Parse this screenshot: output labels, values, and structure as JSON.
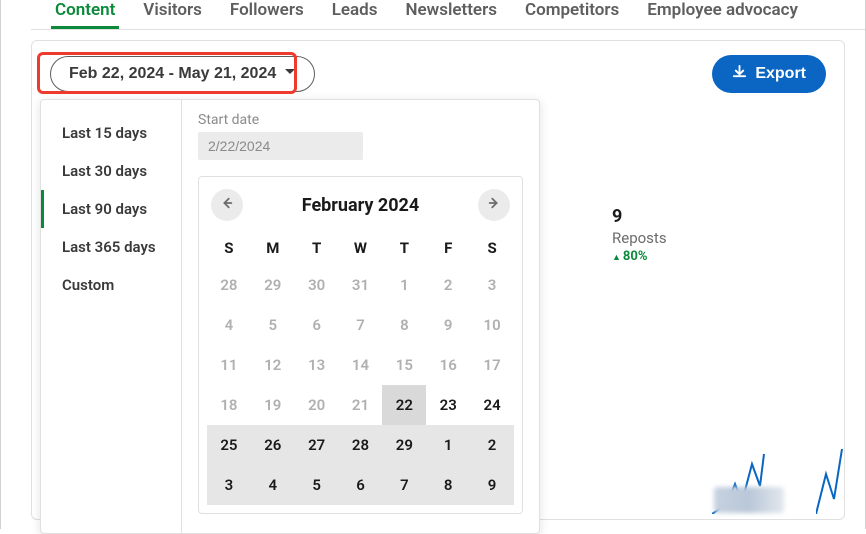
{
  "tabs": [
    {
      "label": "Content",
      "active": true
    },
    {
      "label": "Visitors",
      "active": false
    },
    {
      "label": "Followers",
      "active": false
    },
    {
      "label": "Leads",
      "active": false
    },
    {
      "label": "Newsletters",
      "active": false
    },
    {
      "label": "Competitors",
      "active": false
    },
    {
      "label": "Employee advocacy",
      "active": false
    }
  ],
  "toolbar": {
    "date_range_label": "Feb 22, 2024 - May 21, 2024",
    "export_label": "Export"
  },
  "date_picker": {
    "presets": [
      {
        "label": "Last 15 days",
        "selected": false
      },
      {
        "label": "Last 30 days",
        "selected": false
      },
      {
        "label": "Last 90 days",
        "selected": true
      },
      {
        "label": "Last 365 days",
        "selected": false
      },
      {
        "label": "Custom",
        "selected": false
      }
    ],
    "start_label": "Start date",
    "start_value": "2/22/2024",
    "month_title": "February 2024",
    "dow": [
      "S",
      "M",
      "T",
      "W",
      "T",
      "F",
      "S"
    ],
    "weeks": [
      [
        {
          "n": "28"
        },
        {
          "n": "29"
        },
        {
          "n": "30"
        },
        {
          "n": "31"
        },
        {
          "n": "1"
        },
        {
          "n": "2"
        },
        {
          "n": "3"
        }
      ],
      [
        {
          "n": "4"
        },
        {
          "n": "5"
        },
        {
          "n": "6"
        },
        {
          "n": "7"
        },
        {
          "n": "8"
        },
        {
          "n": "9"
        },
        {
          "n": "10"
        }
      ],
      [
        {
          "n": "11"
        },
        {
          "n": "12"
        },
        {
          "n": "13"
        },
        {
          "n": "14"
        },
        {
          "n": "15"
        },
        {
          "n": "16"
        },
        {
          "n": "17"
        }
      ],
      [
        {
          "n": "18"
        },
        {
          "n": "19"
        },
        {
          "n": "20"
        },
        {
          "n": "21"
        },
        {
          "n": "22",
          "cls": "range-start"
        },
        {
          "n": "23",
          "cls": "active-bold"
        },
        {
          "n": "24",
          "cls": "active-bold"
        }
      ],
      [
        {
          "n": "25",
          "cls": "in-range"
        },
        {
          "n": "26",
          "cls": "in-range"
        },
        {
          "n": "27",
          "cls": "in-range"
        },
        {
          "n": "28",
          "cls": "in-range"
        },
        {
          "n": "29",
          "cls": "in-range"
        },
        {
          "n": "1",
          "cls": "in-range"
        },
        {
          "n": "2",
          "cls": "in-range"
        }
      ],
      [
        {
          "n": "3",
          "cls": "in-range"
        },
        {
          "n": "4",
          "cls": "in-range"
        },
        {
          "n": "5",
          "cls": "in-range"
        },
        {
          "n": "6",
          "cls": "in-range"
        },
        {
          "n": "7",
          "cls": "in-range"
        },
        {
          "n": "8",
          "cls": "in-range"
        },
        {
          "n": "9",
          "cls": "in-range"
        }
      ]
    ]
  },
  "metric": {
    "number": "9",
    "label": "Reposts",
    "delta": "80%"
  }
}
